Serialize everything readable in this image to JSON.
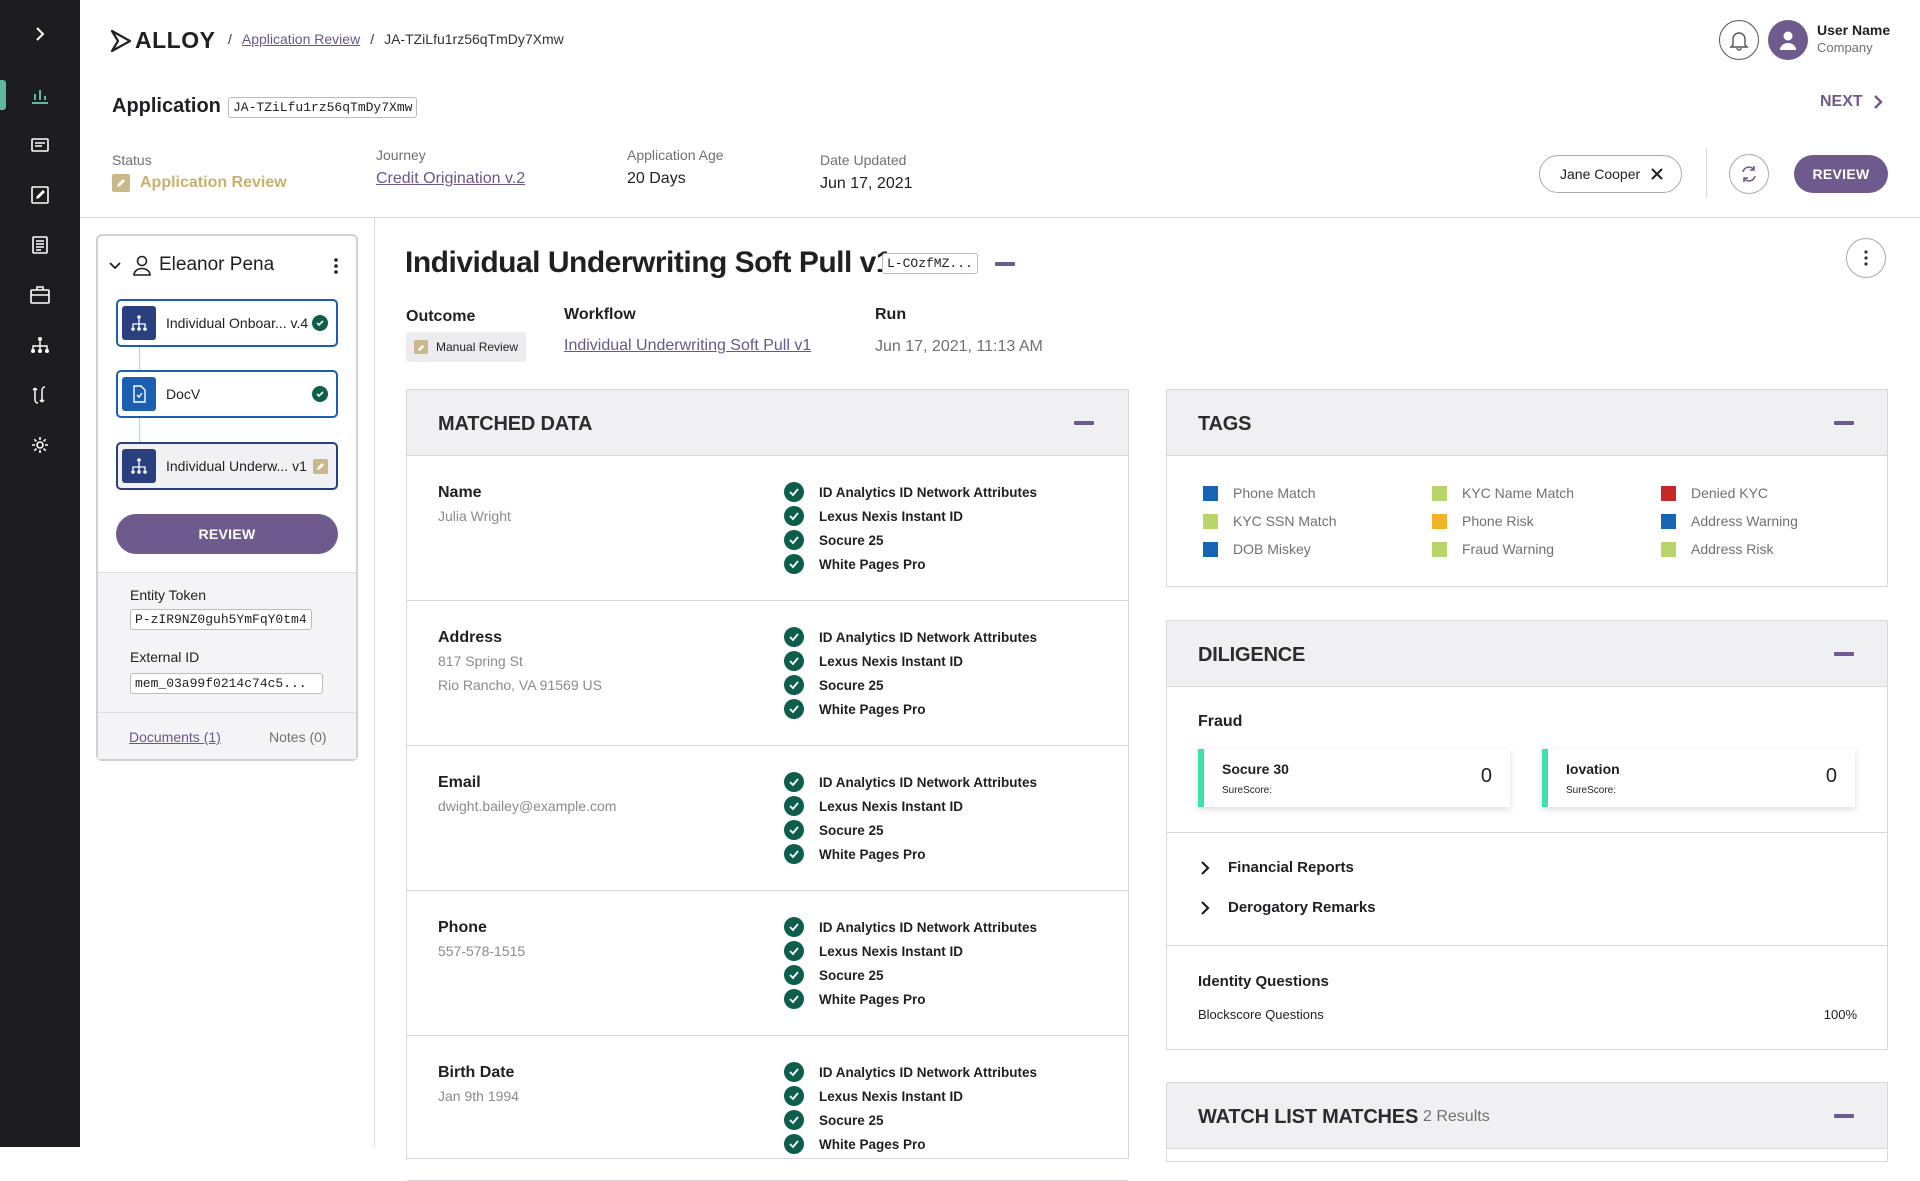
{
  "brand": {
    "logo_text": "ALLOY"
  },
  "breadcrumb": {
    "sep1": "/",
    "link": "Application Review",
    "sep2": "/",
    "current": "JA-TZiLfu1rz56qTmDy7Xmw"
  },
  "user": {
    "name": "User Name",
    "company": "Company"
  },
  "header": {
    "title": "Application",
    "app_token": "JA-TZiLfu1rz56qTmDy7Xmw",
    "next_label": "NEXT",
    "status_label": "Status",
    "status_value": "Application Review",
    "journey_label": "Journey",
    "journey_value": "Credit Origination v.2",
    "age_label": "Application Age",
    "age_value": "20 Days",
    "updated_label": "Date Updated",
    "updated_value": "Jun 17, 2021",
    "assignee": "Jane Cooper",
    "review_label": "REVIEW"
  },
  "sidebar": {
    "entity_name": "Eleanor Pena",
    "nodes": [
      {
        "label": "Individual Onboar... v.4",
        "state": "done"
      },
      {
        "label": "DocV",
        "state": "done"
      },
      {
        "label": "Individual Underw... v1",
        "state": "review"
      }
    ],
    "review_label": "REVIEW",
    "entity_token_label": "Entity Token",
    "entity_token": "P-zIR9NZ0guh5YmFqY0tm4",
    "external_id_label": "External ID",
    "external_id": "mem_03a99f0214c74c5...",
    "documents_link": "Documents (1)",
    "notes_label": "Notes (0)"
  },
  "evaluation": {
    "title": "Individual Underwriting Soft Pull v1",
    "token": "L-COzfMZ...",
    "outcome_label": "Outcome",
    "outcome_value": "Manual Review",
    "workflow_label": "Workflow",
    "workflow_value": "Individual Underwriting Soft Pull v1",
    "run_label": "Run",
    "run_value": "Jun 17, 2021, 11:13 AM"
  },
  "matched_data": {
    "title": "MATCHED DATA",
    "sources": [
      "ID Analytics ID Network Attributes",
      "Lexus Nexis Instant ID",
      "Socure 25",
      "White Pages Pro"
    ],
    "rows": [
      {
        "name": "Name",
        "values": [
          "Julia Wright"
        ]
      },
      {
        "name": "Address",
        "values": [
          "817 Spring St",
          "Rio Rancho, VA 91569 US"
        ]
      },
      {
        "name": "Email",
        "values": [
          "dwight.bailey@example.com"
        ]
      },
      {
        "name": "Phone",
        "values": [
          "557-578-1515"
        ]
      },
      {
        "name": "Birth Date",
        "values": [
          "Jan 9th 1994"
        ]
      }
    ]
  },
  "tags": {
    "title": "TAGS",
    "items": [
      {
        "label": "Phone Match",
        "color": "#1565b4"
      },
      {
        "label": "KYC SSN Match",
        "color": "#b8d46a"
      },
      {
        "label": "DOB Miskey",
        "color": "#1565b4"
      },
      {
        "label": "KYC Name Match",
        "color": "#b8d46a"
      },
      {
        "label": "Phone Risk",
        "color": "#f2b22a"
      },
      {
        "label": "Fraud Warning",
        "color": "#b8d46a"
      },
      {
        "label": "Denied KYC",
        "color": "#c62828"
      },
      {
        "label": "Address Warning",
        "color": "#1565b4"
      },
      {
        "label": "Address Risk",
        "color": "#b8d46a"
      }
    ]
  },
  "diligence": {
    "title": "DILIGENCE",
    "fraud_label": "Fraud",
    "scores": [
      {
        "name": "Socure 30",
        "sub": "SureScore:",
        "value": "0"
      },
      {
        "name": "Iovation",
        "sub": "SureScore:",
        "value": "0"
      }
    ],
    "financial_reports": "Financial Reports",
    "derogatory_remarks": "Derogatory Remarks",
    "identity_questions": "Identity Questions",
    "blockscore_label": "Blockscore Questions",
    "blockscore_value": "100%"
  },
  "watchlist": {
    "title": "WATCH LIST MATCHES",
    "count": "2 Results"
  }
}
